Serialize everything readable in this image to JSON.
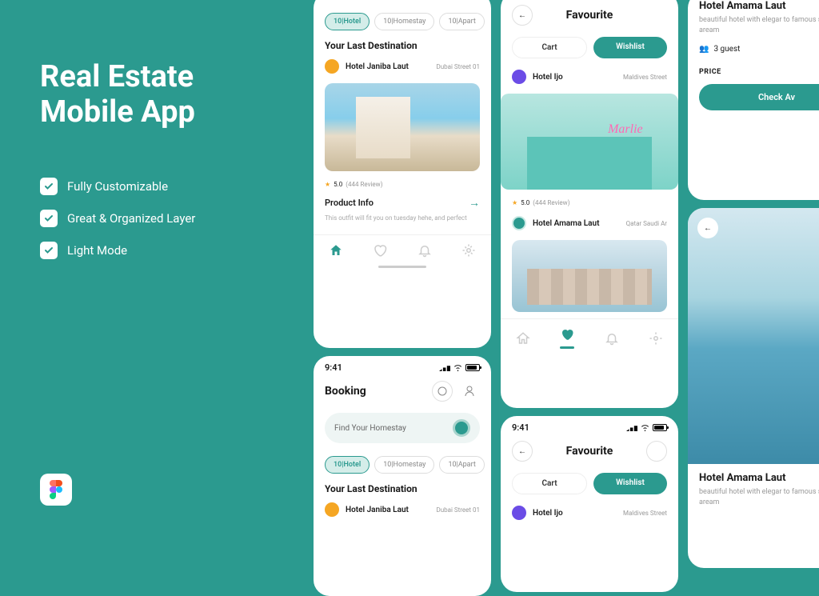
{
  "promo": {
    "title": "Real Estate Mobile App",
    "features": [
      "Fully Customizable",
      "Great & Organized Layer",
      "Light Mode"
    ]
  },
  "status_time": "9:41",
  "screen1": {
    "pills": [
      {
        "label": "10|Hotel",
        "active": true
      },
      {
        "label": "10|Homestay",
        "active": false
      },
      {
        "label": "10|Apart",
        "active": false
      }
    ],
    "section": "Your Last Destination",
    "item": {
      "name": "Hotel Janiba Laut",
      "sub": "Dubai Street 01"
    },
    "rating": "5.0",
    "reviews": "(444 Review)",
    "info_title": "Product Info",
    "info_desc": "This outfit will fit you on tuesday hehe, and perfect"
  },
  "screen2": {
    "title": "Booking",
    "search_placeholder": "Find Your Homestay",
    "pills": [
      {
        "label": "10|Hotel",
        "active": true
      },
      {
        "label": "10|Homestay",
        "active": false
      },
      {
        "label": "10|Apart",
        "active": false
      }
    ],
    "section": "Your Last Destination",
    "item": {
      "name": "Hotel Janiba Laut",
      "sub": "Dubai Street 01"
    }
  },
  "screen3": {
    "title": "Favourite",
    "tabs": {
      "cart": "Cart",
      "wishlist": "Wishlist"
    },
    "item1": {
      "name": "Hotel Ijo",
      "sub": "Maldives Street"
    },
    "marlie": "Marlie",
    "rating": "5.0",
    "reviews": "(444 Review)",
    "item2": {
      "name": "Hotel Amama Laut",
      "sub": "Qatar Saudi Ar"
    }
  },
  "screen4": {
    "title": "Favourite",
    "tabs": {
      "cart": "Cart",
      "wishlist": "Wishlist"
    },
    "item": {
      "name": "Hotel Ijo",
      "sub": "Maldives Street"
    }
  },
  "screen5": {
    "title": "Hotel Amama Laut",
    "desc": "beautiful hotel with elegar to famous shopping aream",
    "guest": "3 guest",
    "price_label": "PRICE",
    "cta": "Check Av"
  },
  "screen6": {
    "title": "Hotel Amama Laut",
    "desc": "beautiful hotel with elegar to famous shopping aream"
  }
}
